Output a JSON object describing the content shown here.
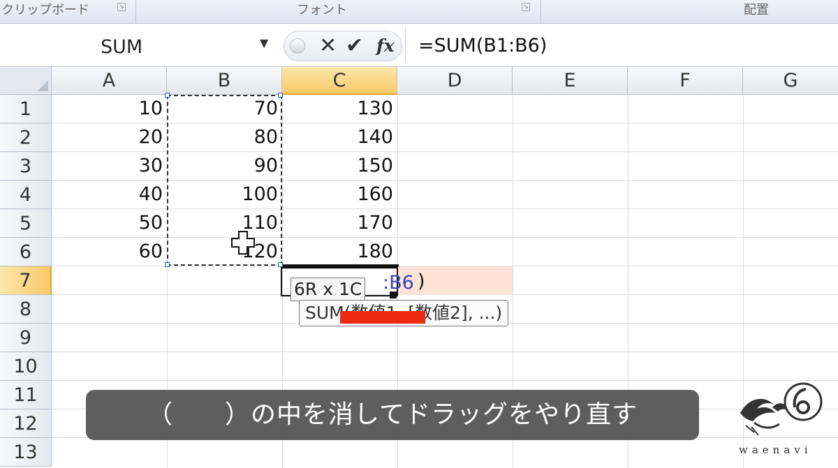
{
  "ribbon": {
    "groups": [
      "クリップボード",
      "フォント",
      "配置"
    ]
  },
  "formula_bar": {
    "name_box": "SUM",
    "cancel_glyph": "✕",
    "enter_glyph": "✔",
    "fx_glyph": "fx",
    "formula": "=SUM(B1:B6)"
  },
  "columns": [
    "A",
    "B",
    "C",
    "D",
    "E",
    "F",
    "G"
  ],
  "rows": [
    "1",
    "2",
    "3",
    "4",
    "5",
    "6",
    "7",
    "8",
    "9",
    "10",
    "11",
    "12",
    "13"
  ],
  "cells": {
    "A": [
      "10",
      "20",
      "30",
      "40",
      "50",
      "60"
    ],
    "B": [
      "70",
      "80",
      "90",
      "100",
      "110",
      "120"
    ],
    "C": [
      "130",
      "140",
      "150",
      "160",
      "170",
      "180"
    ]
  },
  "edit": {
    "ref": ":B6",
    "close_paren": ")",
    "size_tooltip": "6R x 1C",
    "function_tooltip": "SUM(数値1, [数値2], ...)"
  },
  "caption": "（　　）の中を消してドラッグをやり直す",
  "logo": {
    "icon": "bird-crest-icon",
    "text": "waenavi"
  },
  "colors": {
    "active_header": "#f7c96a",
    "edit_cell_fill": "#fbe3d6",
    "reference_text": "#3b41b5",
    "highlight_bar": "#ee2a10"
  }
}
